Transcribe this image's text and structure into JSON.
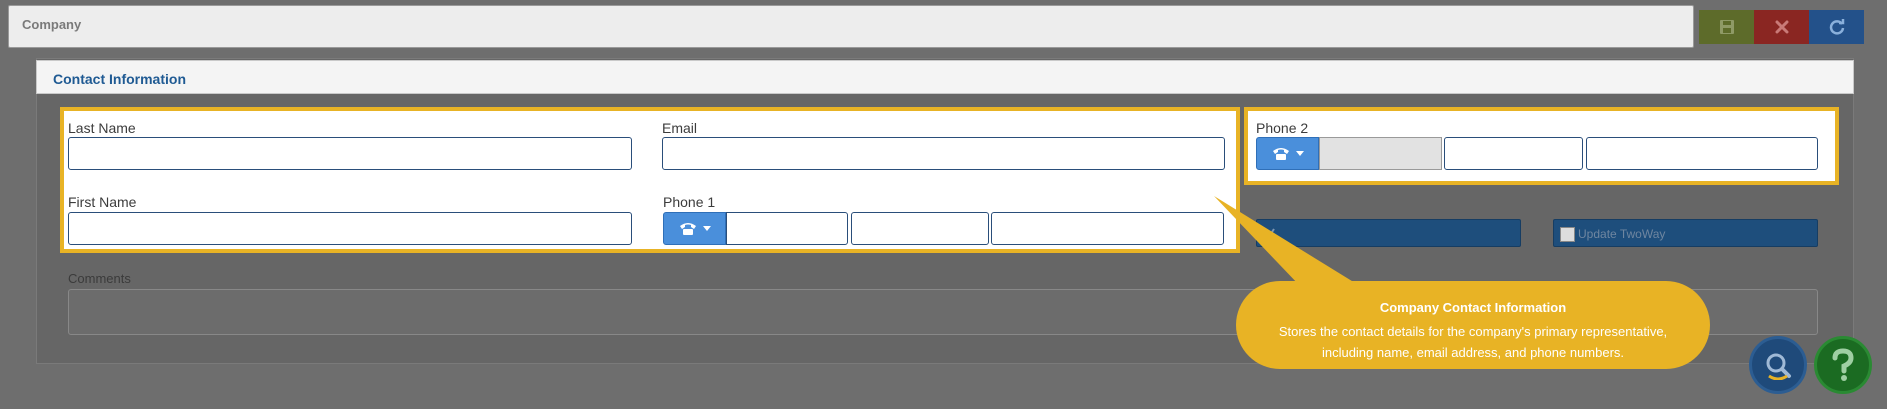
{
  "header": {
    "title": "Company"
  },
  "toolbar": {
    "save_icon": "floppy-disk-icon",
    "cancel_icon": "close-icon",
    "refresh_icon": "refresh-icon"
  },
  "section": {
    "title": "Contact Information"
  },
  "form": {
    "last_name": {
      "label": "Last Name",
      "value": ""
    },
    "email": {
      "label": "Email",
      "value": ""
    },
    "first_name": {
      "label": "First Name",
      "value": ""
    },
    "phone1": {
      "label": "Phone 1",
      "type_icon": "telephone-icon"
    },
    "phone2": {
      "label": "Phone 2",
      "type_icon": "telephone-icon"
    },
    "update_twoway": {
      "label": "Update TwoWay"
    },
    "comments": {
      "label": "Comments",
      "value": ""
    }
  },
  "callout": {
    "title": "Company Contact Information",
    "body": "Stores the contact details for the company's primary representative, including name, email address, and phone numbers."
  },
  "colors": {
    "highlight": "#e8b325",
    "section_title": "#1f5a93",
    "phone_button": "#4a8fdb",
    "save_button": "#5d6b2a",
    "cancel_button": "#8a2622",
    "refresh_button": "#23518a"
  }
}
